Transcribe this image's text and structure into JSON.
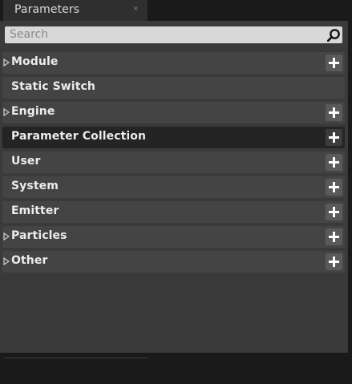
{
  "tab": {
    "title": "Parameters",
    "close_glyph": "×"
  },
  "search": {
    "placeholder": "Search",
    "icon": "search-icon"
  },
  "rows": [
    {
      "label": "Module",
      "expandable": true,
      "add": true,
      "highlighted": false
    },
    {
      "label": "Static Switch",
      "expandable": false,
      "add": false,
      "highlighted": false
    },
    {
      "label": "Engine",
      "expandable": true,
      "add": true,
      "highlighted": false
    },
    {
      "label": "Parameter Collection",
      "expandable": false,
      "add": true,
      "highlighted": true
    },
    {
      "label": "User",
      "expandable": false,
      "add": true,
      "highlighted": false
    },
    {
      "label": "System",
      "expandable": false,
      "add": true,
      "highlighted": false
    },
    {
      "label": "Emitter",
      "expandable": false,
      "add": true,
      "highlighted": false
    },
    {
      "label": "Particles",
      "expandable": true,
      "add": true,
      "highlighted": false
    },
    {
      "label": "Other",
      "expandable": true,
      "add": true,
      "highlighted": false
    }
  ],
  "colors": {
    "background": "#1a1a1a",
    "panel": "#3a3a3a",
    "row": "#444444",
    "row_highlight": "#242424",
    "search_field": "#d8d8d8"
  }
}
